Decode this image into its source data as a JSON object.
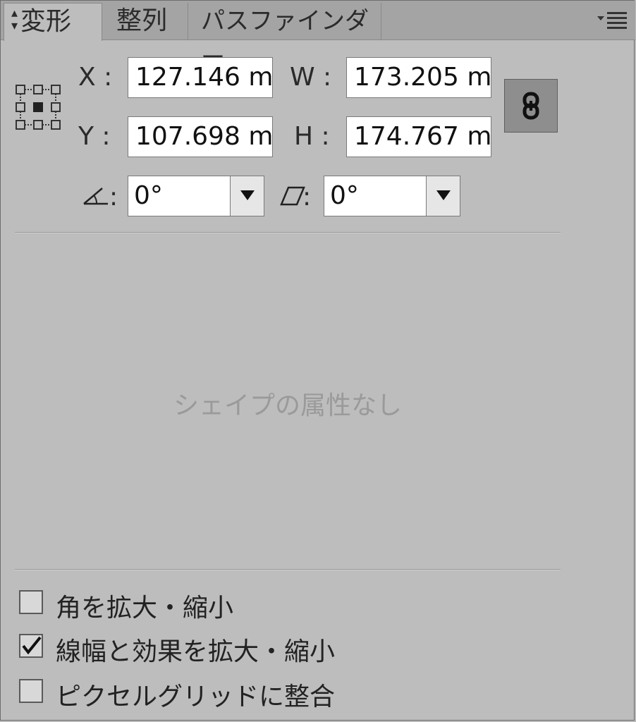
{
  "tabs": [
    {
      "label": "変形",
      "active": true
    },
    {
      "label": "整列",
      "active": false
    },
    {
      "label": "パスファインダー",
      "active": false
    }
  ],
  "fields": {
    "x": {
      "label": "X :",
      "value": "127.146 m"
    },
    "y": {
      "label": "Y :",
      "value": "107.698 m"
    },
    "w": {
      "label": "W :",
      "value": "173.205 m"
    },
    "h": {
      "label": "H :",
      "value": "174.767 m"
    }
  },
  "rotate": {
    "label": ":",
    "value": "0°"
  },
  "shear": {
    "label": ":",
    "value": "0°"
  },
  "no_attributes": "シェイプの属性なし",
  "options": [
    {
      "label": "角を拡大・縮小",
      "checked": false
    },
    {
      "label": "線幅と効果を拡大・縮小",
      "checked": true
    },
    {
      "label": "ピクセルグリッドに整合",
      "checked": false
    }
  ],
  "colors": {
    "panel": "#bdbdbd",
    "tabbar": "#a4a4a4"
  },
  "icons": [
    "reference-point-icon",
    "link-proportions-icon",
    "rotate-angle-icon",
    "shear-icon",
    "panel-menu-icon"
  ]
}
